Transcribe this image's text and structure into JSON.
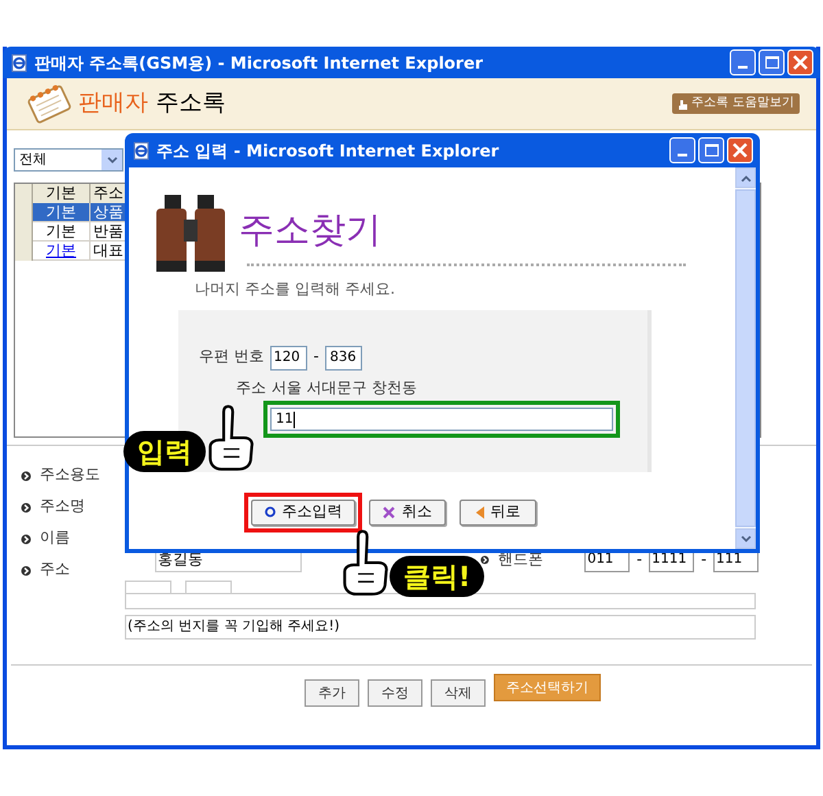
{
  "main_window": {
    "title": "판매자 주소록(GSM용) - Microsoft Internet Explorer",
    "header": {
      "title_highlight": "판매자",
      "title_rest": "주소록",
      "help_button": "주소록 도움말보기"
    },
    "filter": {
      "value": "전체"
    },
    "list": {
      "columns": [
        "기본",
        "주소"
      ],
      "rows": [
        {
          "cells": [
            "기본",
            "상품"
          ],
          "selected": true,
          "link": false
        },
        {
          "cells": [
            "기본",
            "반품"
          ],
          "selected": false,
          "link": false
        },
        {
          "cells": [
            "기본",
            "대표"
          ],
          "selected": false,
          "link": true
        }
      ]
    },
    "form": {
      "labels": [
        "주소용도",
        "주소명",
        "이름",
        "주소"
      ],
      "name_value": "홍길동",
      "phone_label": "핸드폰",
      "phone_values": [
        "011",
        "1111",
        "111"
      ],
      "separator": "-",
      "note_value": "(주소의 번지를 꼭 기입해 주세요!)"
    },
    "buttons": [
      {
        "label": "추가",
        "kind": "plain"
      },
      {
        "label": "수정",
        "kind": "plain"
      },
      {
        "label": "삭제",
        "kind": "plain"
      },
      {
        "label": "주소선택하기",
        "kind": "primary"
      }
    ]
  },
  "dialog": {
    "title": "주소 입력 - Microsoft Internet Explorer",
    "heading": "주소찾기",
    "instruction": "나머지 주소를 입력해 주세요.",
    "postcode_label": "우편 번호",
    "postcode": [
      "120",
      "836"
    ],
    "separator": "-",
    "address_label": "주소",
    "address_value": "서울 서대문구 창천동",
    "detail_value": "11",
    "buttons": [
      {
        "label": "주소입력",
        "kind": "confirm",
        "highlighted": true
      },
      {
        "label": "취소",
        "kind": "cancel",
        "highlighted": false
      },
      {
        "label": "뒤로",
        "kind": "back",
        "highlighted": false
      }
    ]
  },
  "callouts": [
    {
      "text": "입력",
      "kind": "input"
    },
    {
      "text": "클릭!",
      "kind": "click"
    }
  ]
}
